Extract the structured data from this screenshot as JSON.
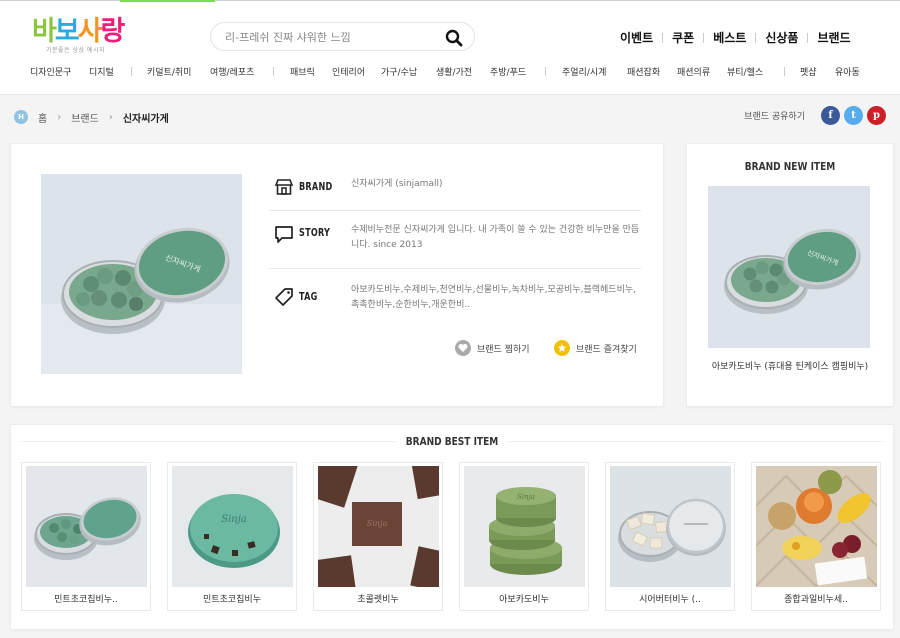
{
  "logo": {
    "text_parts": [
      "바",
      "보",
      "사",
      "랑"
    ],
    "subtitle": "기분좋은 상상 예시지"
  },
  "search": {
    "placeholder": "리-프레쉬 진짜 샤워한 느낌"
  },
  "top_menu": [
    "이벤트",
    "쿠폰",
    "베스트",
    "신상품",
    "브랜드"
  ],
  "categories": [
    "디자인문구",
    "디지털",
    "키덜트/취미",
    "여행/레포츠",
    "패브릭",
    "인테리어",
    "가구/수납",
    "생활/가전",
    "주방/푸드",
    "주얼리/시계",
    "패션잡화",
    "패션의류",
    "뷰티/헬스",
    "펫샵",
    "유아동"
  ],
  "breadcrumb": {
    "home_badge": "H",
    "items": [
      "홈",
      "브랜드",
      "신자씨가게"
    ]
  },
  "share": {
    "label": "브랜드 공유하기",
    "buttons": [
      "f",
      "t",
      "p"
    ]
  },
  "brand": {
    "brand_label": "BRAND",
    "brand_value": "신자씨가게 (sinjamall)",
    "story_label": "STORY",
    "story_value": "수제비누전문 신자씨가게 입니다. 내 가족이 쓸 수 있는 건강한 비누만을 만듭니다. since 2013",
    "tag_label": "TAG",
    "tag_value": "아보카도비누,수제비누,천연비누,선물비누,녹차비누,모공비누,블랙헤드비누,촉촉한비누,순한비누,개운한비..",
    "like_label": "브랜드 찜하기",
    "fav_label": "브랜드 즐겨찾기",
    "tin_text": "신자씨가게"
  },
  "new_item": {
    "title": "BRAND NEW ITEM",
    "name": "아보카도비누 (휴대용 틴케이스 캠핑비누)"
  },
  "best": {
    "title": "BRAND BEST ITEM",
    "items": [
      {
        "name": "민트초코칩비누.."
      },
      {
        "name": "민트초코칩비누"
      },
      {
        "name": "초콜렛비누"
      },
      {
        "name": "아보카도비누"
      },
      {
        "name": "시어버터비누 (.."
      },
      {
        "name": "종합과일비누세.."
      }
    ]
  },
  "colors": {
    "facebook": "#3b5998",
    "twitter": "#55acee",
    "pinterest": "#cb2027",
    "tin": "#5f9e82",
    "bg": "#f4f4f4"
  }
}
